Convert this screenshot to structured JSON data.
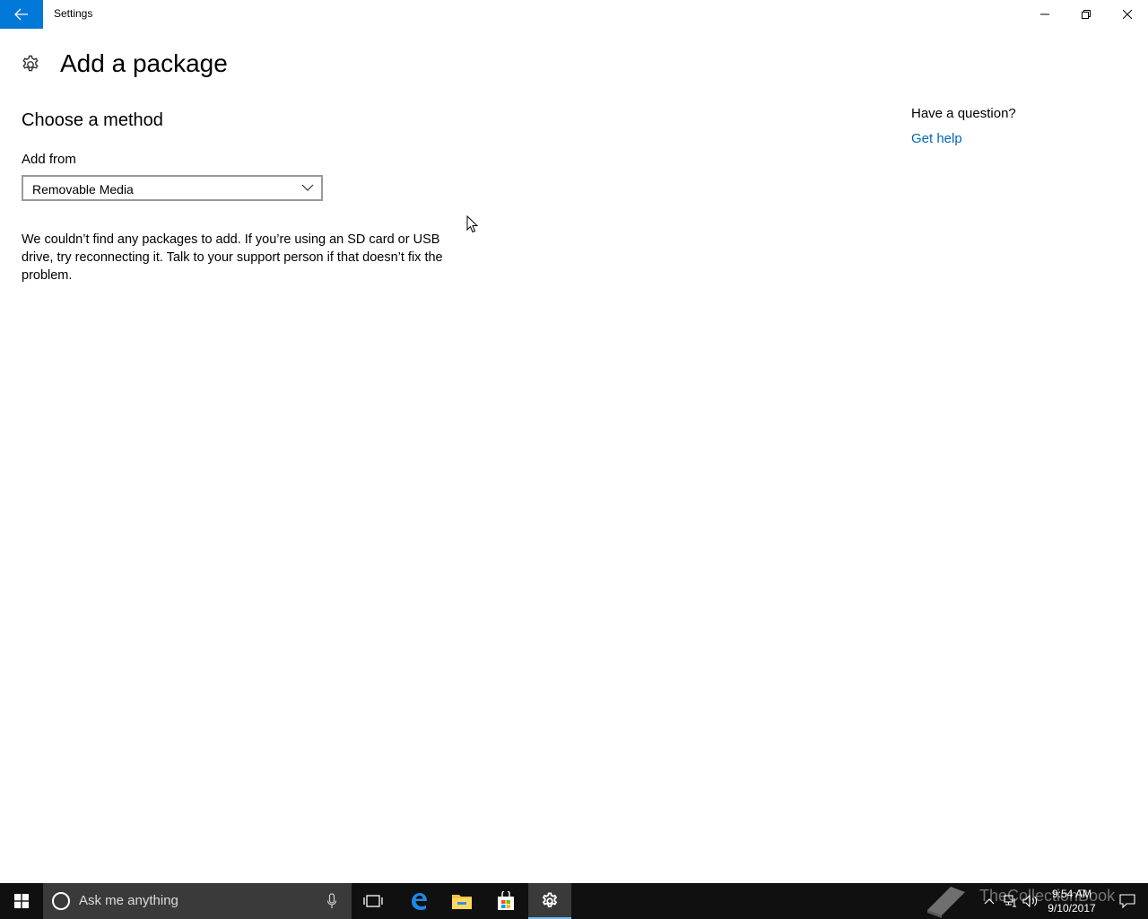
{
  "window": {
    "title": "Settings"
  },
  "page": {
    "title": "Add a package",
    "section_title": "Choose a method",
    "add_from_label": "Add from",
    "add_from_selected": "Removable Media",
    "message": "We couldn’t find any packages to add. If you’re using an SD card or USB drive, try reconnecting it. Talk to your support person if that doesn’t fix the problem."
  },
  "help": {
    "heading": "Have a question?",
    "link": "Get help"
  },
  "taskbar": {
    "search_placeholder": "Ask me anything",
    "pinned": [
      "task-view-icon",
      "edge-icon",
      "file-explorer-icon",
      "store-icon",
      "settings-icon"
    ],
    "active_app": "settings-icon",
    "time": "9:54 AM",
    "date": "9/10/2017",
    "watermark": "TheCollectionBook"
  },
  "colors": {
    "accent": "#0078d7",
    "link": "#0067b8",
    "taskbar": "#101010"
  }
}
